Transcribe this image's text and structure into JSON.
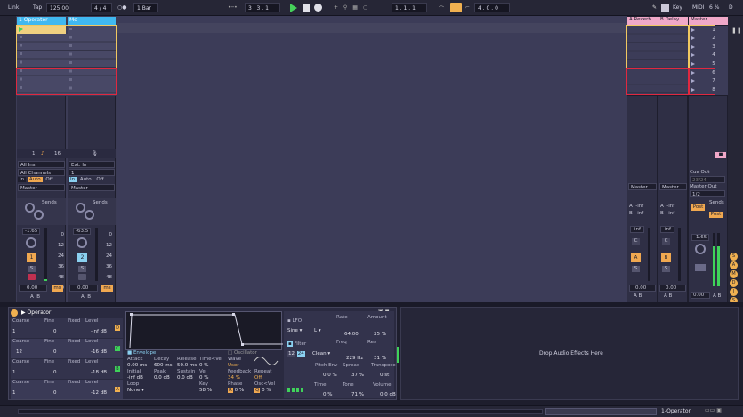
{
  "topbar": {
    "link": "Link",
    "tap": "Tap",
    "tempo": "125.00",
    "meter": "4 / 4",
    "metro": "○●",
    "quant": "1 Bar",
    "position": "3 .  3 .  1",
    "loop_start": "1 .  1 .  1",
    "loop_len": "4 .  0 .  0",
    "key": "Key",
    "midi": "MIDI",
    "cpu": "6 %",
    "disk": "D"
  },
  "tracks": [
    {
      "name": "1 Operator",
      "color": "#40b8f0",
      "num": "1",
      "io_in": "All Ins",
      "io_ch": "All Channels",
      "mon_in": "In",
      "mon_auto": "Auto",
      "mon_off": "Off",
      "out": "Master",
      "sends": "Sends",
      "vol": "-1.65",
      "arm_num": "1",
      "solo": "S",
      "val": "0.00",
      "ms": "ms",
      "ab_a": "A",
      "ab_b": "B",
      "count": "16",
      "db": [
        "0",
        "12",
        "24",
        "36",
        "48",
        "60"
      ]
    },
    {
      "name": "Mc",
      "color": "#40b8f0",
      "num": "2",
      "io_in": "Ext. In",
      "io_ch": "1",
      "mon_in": "In",
      "mon_auto": "Auto",
      "mon_off": "Off",
      "out": "Master",
      "sends": "Sends",
      "vol": "-63.5",
      "arm_num": "2",
      "solo": "S",
      "val": "0.00",
      "ms": "ms",
      "ab_a": "A",
      "ab_b": "B",
      "db": [
        "0",
        "12",
        "24",
        "36",
        "48",
        "60"
      ]
    }
  ],
  "returns": [
    {
      "name": "A Reverb",
      "out": "Master",
      "send_a": "A",
      "send_a_val": "-inf",
      "send_b": "B",
      "send_b_val": "-inf",
      "vol": "-inf",
      "c": "C",
      "btn": "A",
      "solo": "S",
      "val": "0.00",
      "ab": "A B"
    },
    {
      "name": "B Delay",
      "out": "Master",
      "send_a": "A",
      "send_a_val": "-inf",
      "send_b": "B",
      "send_b_val": "-inf",
      "vol": "-inf",
      "c": "C",
      "btn": "B",
      "solo": "S",
      "val": "0.00",
      "ab": "A B"
    }
  ],
  "master": {
    "name": "Master",
    "scenes": [
      "1",
      "2",
      "3",
      "4",
      "5",
      "6",
      "7",
      "8"
    ],
    "cue_out": "Cue Out",
    "cue_val": "23/24",
    "master_out": "Master Out",
    "master_val": "1/2",
    "sends": "Sends",
    "post1": "Post",
    "post2": "Post",
    "vol": "-1.65",
    "val": "0.00",
    "ab": "A B"
  },
  "operator": {
    "title": "Operator",
    "osc_rows": [
      {
        "coarse": "Coarse",
        "fine": "Fine",
        "fixed": "Fixed",
        "level": "Level",
        "c_val": "1",
        "f_val": "0",
        "l_val": "-inf dB",
        "tag": "D"
      },
      {
        "coarse": "Coarse",
        "fine": "Fine",
        "fixed": "Fixed",
        "level": "Level",
        "c_val": "12",
        "f_val": "0",
        "l_val": "-16 dB",
        "tag": "C"
      },
      {
        "coarse": "Coarse",
        "fine": "Fine",
        "fixed": "Fixed",
        "level": "Level",
        "c_val": "1",
        "f_val": "0",
        "l_val": "-18 dB",
        "tag": "B"
      },
      {
        "coarse": "Coarse",
        "fine": "Fine",
        "fixed": "Fixed",
        "level": "Level",
        "c_val": "1",
        "f_val": "0",
        "l_val": "-12 dB",
        "tag": "A"
      }
    ],
    "env_label": "Envelope",
    "osc_label": "Oscillator",
    "env_params": {
      "attack": "Attack",
      "attack_v": "0.00 ms",
      "decay": "Decay",
      "decay_v": "600 ms",
      "release": "Release",
      "release_v": "50.0 ms",
      "time_vel": "Time<Vel",
      "time_vel_v": "0 %",
      "wave": "Wave",
      "wave_v": "User",
      "initial": "Initial",
      "initial_v": "-inf dB",
      "peak": "Peak",
      "peak_v": "0.0 dB",
      "sustain": "Sustain",
      "sustain_v": "0.0 dB",
      "vel": "Vel",
      "vel_v": "0 %",
      "feedback": "Feedback",
      "repeat": "Repeat",
      "feedback_v": "34 %",
      "repeat_v": "Off",
      "loop": "Loop",
      "loop_v": "None",
      "key": "Key",
      "key_v": "58 %",
      "phase": "Phase",
      "phase_v": "0 %",
      "osc_vel": "Osc<Vel",
      "osc_vel_v": "0 %",
      "r_tag": "R",
      "q_tag": "Q"
    },
    "lfo": {
      "lfo": "LFO",
      "rate": "Rate",
      "amount": "Amount",
      "shape": "Sine",
      "l": "L",
      "rate_v": "64.00",
      "amount_v": "25 %",
      "filter": "Filter",
      "freq": "Freq",
      "res": "Res",
      "f12": "12",
      "f24": "24",
      "clean": "Clean",
      "freq_v": "229 Hz",
      "res_v": "31 %",
      "pitch_env": "Pitch Env",
      "spread": "Spread",
      "transpose": "Transpose",
      "pitch_v": "0.0 %",
      "spread_v": "37 %",
      "transpose_v": "0 st",
      "time": "Time",
      "tone": "Tone",
      "volume": "Volume",
      "time_v": "0 %",
      "tone_v": "71 %",
      "volume_v": "0.0 dB"
    }
  },
  "dropzone": "Drop Audio Effects Here",
  "bottombar": {
    "track": "1-Operator"
  },
  "side_icons": [
    "S",
    "A",
    "M",
    "D",
    "I",
    "S",
    "O"
  ],
  "colors": {
    "accent": "#40b8f0",
    "orange": "#f0a850",
    "return": "#f0a8c8",
    "meter": "#3fd25a",
    "selection": "#f0d060",
    "red_selection": "#e02840"
  }
}
